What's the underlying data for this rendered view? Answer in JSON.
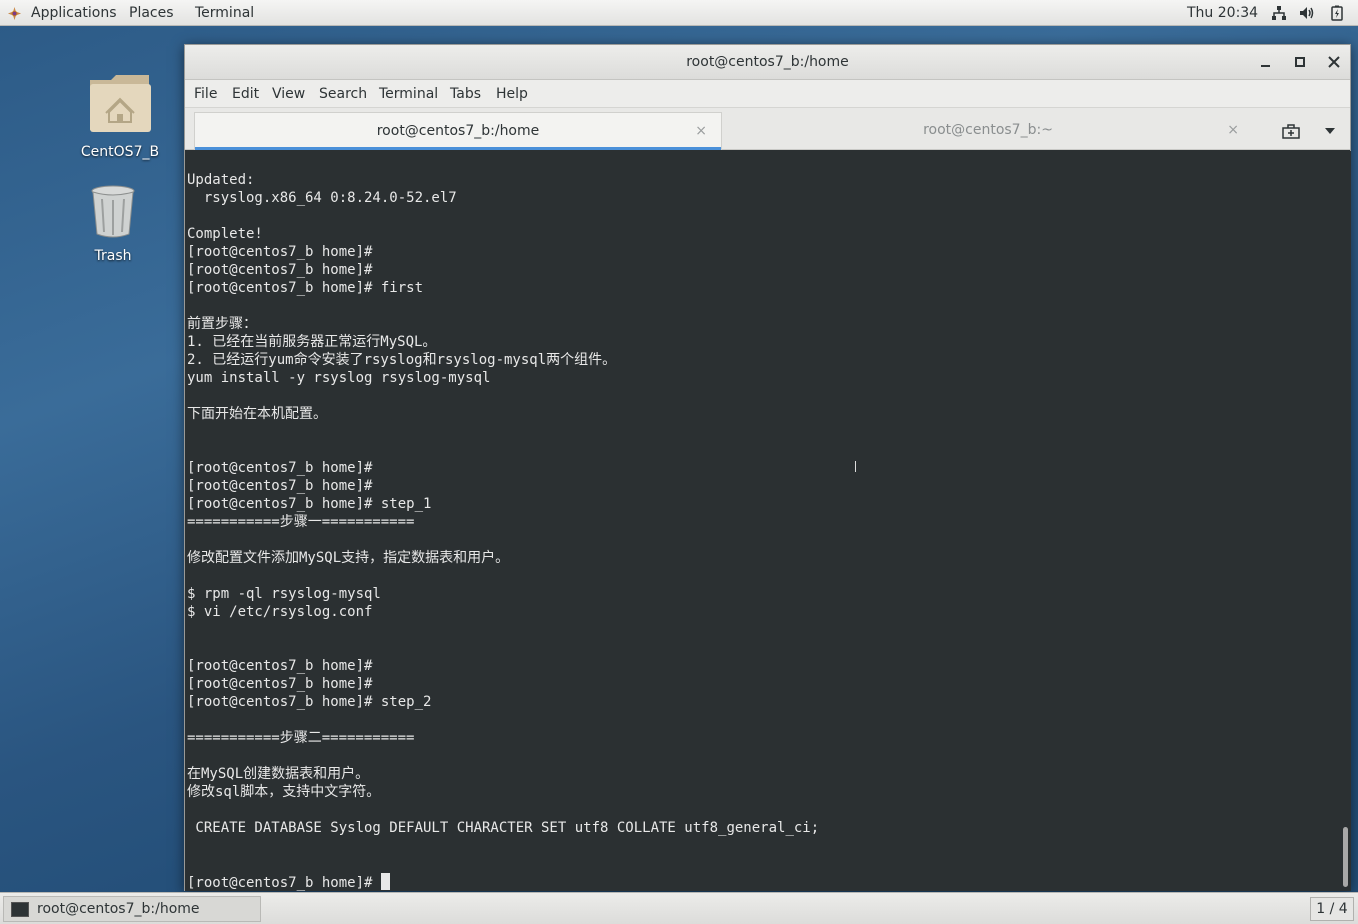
{
  "top_panel": {
    "applications": "Applications",
    "places": "Places",
    "terminal": "Terminal",
    "clock": "Thu 20:34",
    "tray_icons": [
      "network-icon",
      "volume-icon",
      "battery-icon"
    ]
  },
  "desktop": {
    "icons": [
      {
        "label": "CentOS7_B",
        "icon": "home-folder-icon"
      },
      {
        "label": "Trash",
        "icon": "trash-icon"
      }
    ]
  },
  "window": {
    "title": "root@centos7_b:/home",
    "menu": [
      "File",
      "Edit",
      "View",
      "Search",
      "Terminal",
      "Tabs",
      "Help"
    ],
    "tabs": [
      {
        "label": "root@centos7_b:/home",
        "active": true
      },
      {
        "label": "root@centos7_b:~",
        "active": false
      }
    ],
    "terminal_lines": [
      "Updated:",
      "  rsyslog.x86_64 0:8.24.0-52.el7",
      "",
      "Complete!",
      "[root@centos7_b home]#",
      "[root@centos7_b home]#",
      "[root@centos7_b home]# first",
      "",
      "前置步骤：",
      "1. 已经在当前服务器正常运行MySQL。",
      "2. 已经运行yum命令安装了rsyslog和rsyslog-mysql两个组件。",
      "yum install -y rsyslog rsyslog-mysql",
      "",
      "下面开始在本机配置。",
      "",
      "",
      "[root@centos7_b home]#",
      "[root@centos7_b home]#",
      "[root@centos7_b home]# step_1",
      "===========步骤一===========",
      "",
      "修改配置文件添加MySQL支持，指定数据表和用户。",
      "",
      "$ rpm -ql rsyslog-mysql",
      "$ vi /etc/rsyslog.conf",
      "",
      "",
      "[root@centos7_b home]#",
      "[root@centos7_b home]#",
      "[root@centos7_b home]# step_2",
      "",
      "===========步骤二===========",
      "",
      "在MySQL创建数据表和用户。",
      "修改sql脚本，支持中文字符。",
      "",
      " CREATE DATABASE Syslog DEFAULT CHARACTER SET utf8 COLLATE utf8_general_ci;",
      "",
      ""
    ],
    "prompt_line": "[root@centos7_b home]# "
  },
  "taskbar": {
    "task_label": "root@centos7_b:/home",
    "workspace": "1 / 4"
  }
}
